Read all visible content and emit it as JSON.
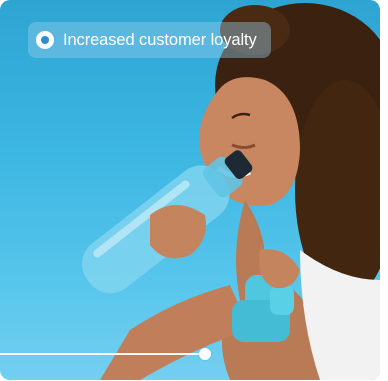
{
  "feature": {
    "label": "Increased customer loyalty",
    "icon": "radio-dot-icon"
  },
  "slider": {
    "progress": 0.54
  },
  "colors": {
    "background": "#3cb6e2",
    "badge_icon_dot": "#2a8fca"
  }
}
